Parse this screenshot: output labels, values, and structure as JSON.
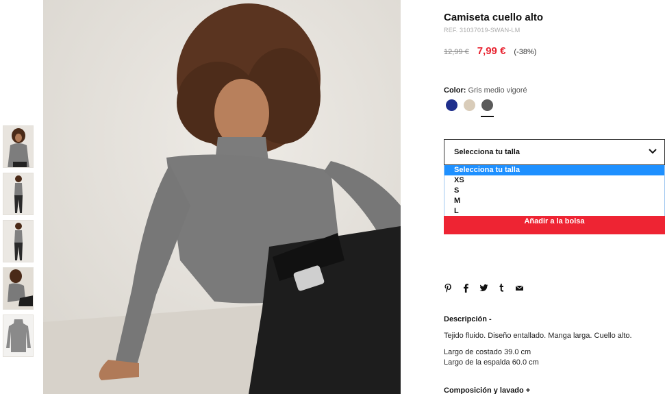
{
  "product": {
    "title": "Camiseta cuello alto",
    "ref": "REF. 31037019-SWAN-LM",
    "old_price": "12,99 €",
    "new_price": "7,99 €",
    "discount": "(-38%)"
  },
  "color": {
    "label": "Color:",
    "value": "Gris medio vigoré",
    "swatches": [
      {
        "name": "navy",
        "hex": "#1f2f8c"
      },
      {
        "name": "beige",
        "hex": "#d9ccb9"
      },
      {
        "name": "grey",
        "hex": "#5a5a5a"
      }
    ],
    "selected_index": 2
  },
  "size": {
    "placeholder": "Selecciona tu talla",
    "options": [
      "Selecciona tu talla",
      "XS",
      "S",
      "M",
      "L"
    ],
    "highlighted_index": 0
  },
  "actions": {
    "add_to_bag": "Añadir a la bolsa"
  },
  "share": {
    "icons": [
      "pinterest-icon",
      "facebook-icon",
      "twitter-icon",
      "tumblr-icon",
      "email-icon"
    ]
  },
  "description": {
    "title": "Descripción -",
    "text": "Tejido fluido. Diseño entallado. Manga larga. Cuello alto.",
    "measure_side": "Largo de costado 39.0 cm",
    "measure_back": "Largo de la espalda 60.0 cm"
  },
  "composition": {
    "title": "Composición y lavado +"
  },
  "colors": {
    "accent_red": "#ee2433",
    "price_red": "#e8222f",
    "dropdown_highlight": "#1e90ff"
  }
}
